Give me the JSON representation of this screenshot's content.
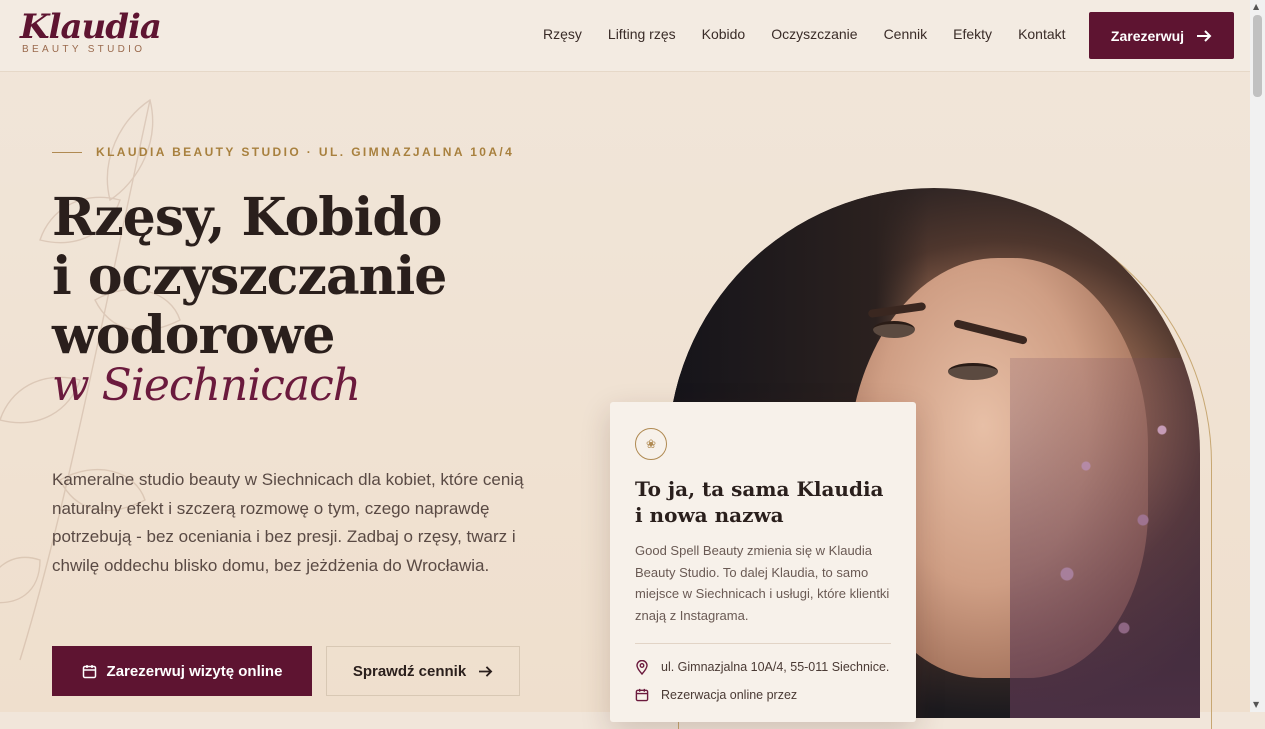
{
  "header": {
    "logo_name": "Klaudia",
    "logo_sub": "BEAUTY STUDIO",
    "nav": [
      "Rzęsy",
      "Lifting rzęs",
      "Kobido",
      "Oczyszczanie",
      "Cennik",
      "Efekty",
      "Kontakt"
    ],
    "cta_label": "Zarezerwuj"
  },
  "hero": {
    "eyebrow": "KLAUDIA BEAUTY STUDIO · UL. GIMNAZJALNA 10A/4",
    "title_lines": [
      "Rzęsy, Kobido",
      "i oczyszczanie",
      "wodorowe"
    ],
    "script": "w Siechnicach",
    "description": "Kameralne studio beauty w Siechnicach dla kobiet, które cenią naturalny efekt i szczerą rozmowę o tym, czego naprawdę potrzebują - bez oceniania i bez presji. Zadbaj o rzęsy, twarz i chwilę oddechu blisko domu, bez jeżdżenia do Wrocławia.",
    "primary_button": "Zarezerwuj wizytę online",
    "secondary_button": "Sprawdź cennik"
  },
  "card": {
    "title": "To ja, ta sama Klaudia i nowa nazwa",
    "text": "Good Spell Beauty zmienia się w Klaudia Beauty Studio. To dalej Klaudia, to samo miejsce w Siechnicach i usługi, które klientki znają z Instagrama.",
    "address": "ul. Gimnazjalna 10A/4, 55-011 Siechnice.",
    "booking": "Rezerwacja online przez"
  },
  "colors": {
    "brand": "#5e1431",
    "accent_gold": "#a8803e",
    "background": "#efe1d1"
  },
  "icons": {
    "cta_arrow": "arrow-right-icon",
    "calendar": "calendar-icon",
    "location": "location-pin-icon",
    "card_badge": "lotus-icon"
  }
}
